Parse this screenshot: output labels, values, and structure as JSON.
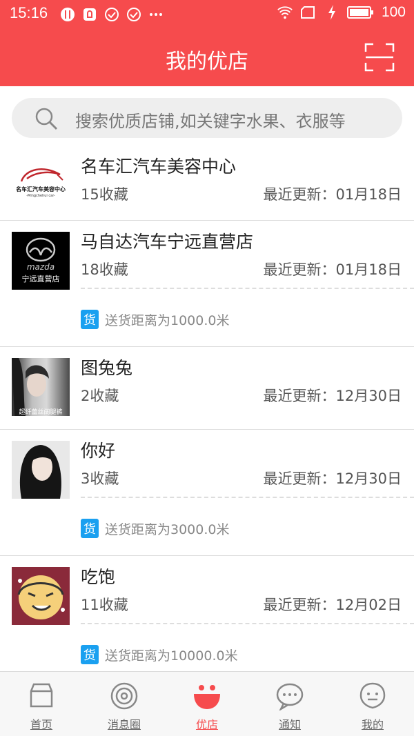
{
  "status_bar": {
    "time": "15:16",
    "battery_level": "100",
    "left_icons": [
      "food-icon",
      "notification-icon",
      "check-circle-icon",
      "check-circle-icon",
      "more-dots-icon"
    ],
    "right_icons": [
      "wifi-icon",
      "sim-icon",
      "charging-icon",
      "battery-icon"
    ]
  },
  "header": {
    "title": "我的优店",
    "scan_icon": "scan-icon"
  },
  "search": {
    "placeholder": "搜索优质店铺,如关键字水果、衣服等",
    "icon": "search-icon"
  },
  "shops": [
    {
      "name": "名车汇汽车美容中心",
      "favorites": "15收藏",
      "updated": "最近更新：01月18日",
      "thumb_text": "名车汇汽车美容中心",
      "thumb_subtext": "-Mingchehui car-"
    },
    {
      "name": "马自达汽车宁远直营店",
      "favorites": "18收藏",
      "updated": "最近更新：01月18日",
      "delivery_badge": "货",
      "delivery": "送货距离为1000.0米",
      "thumb_brand": "mazda",
      "thumb_text": "宁远直营店"
    },
    {
      "name": "图兔兔",
      "favorites": "2收藏",
      "updated": "最近更新：12月30日",
      "thumb_caption": "超纤蕾丝阔腿裤"
    },
    {
      "name": "你好",
      "favorites": "3收藏",
      "updated": "最近更新：12月30日",
      "delivery_badge": "货",
      "delivery": "送货距离为3000.0米"
    },
    {
      "name": "吃饱",
      "favorites": "11收藏",
      "updated": "最近更新：12月02日",
      "delivery_badge": "货",
      "delivery": "送货距离为10000.0米"
    }
  ],
  "tabs": [
    {
      "label": "首页",
      "icon": "home-store-icon",
      "active": false
    },
    {
      "label": "消息圈",
      "icon": "message-circle-icon",
      "active": false
    },
    {
      "label": "优店",
      "icon": "smile-store-icon",
      "active": true
    },
    {
      "label": "通知",
      "icon": "chat-bubble-icon",
      "active": false
    },
    {
      "label": "我的",
      "icon": "profile-face-icon",
      "active": false
    }
  ],
  "colors": {
    "primary": "#f64b4d",
    "delivery_badge": "#1aa0f0",
    "tab_active": "#f64b4d",
    "tab_inactive": "#666666"
  }
}
